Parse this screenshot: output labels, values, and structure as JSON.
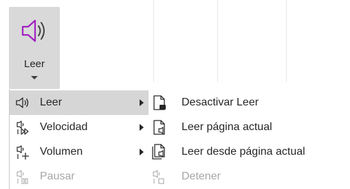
{
  "ribbon": {
    "read_button_label": "Leer",
    "accent_color": "#a020c0"
  },
  "menu": {
    "items": [
      {
        "label": "Leer",
        "icon": "speaker-icon",
        "has_submenu": true,
        "selected": true,
        "enabled": true
      },
      {
        "label": "Velocidad",
        "icon": "speed-icon",
        "has_submenu": true,
        "selected": false,
        "enabled": true
      },
      {
        "label": "Volumen",
        "icon": "volume-icon",
        "has_submenu": true,
        "selected": false,
        "enabled": true
      },
      {
        "label": "Pausar",
        "icon": "pause-icon",
        "has_submenu": false,
        "selected": false,
        "enabled": false
      }
    ]
  },
  "submenu": {
    "items": [
      {
        "label": "Desactivar Leer",
        "icon": "stop-reading-icon",
        "enabled": true
      },
      {
        "label": "Leer página actual",
        "icon": "read-page-icon",
        "enabled": true
      },
      {
        "label": "Leer desde página actual",
        "icon": "read-from-page-icon",
        "enabled": true
      },
      {
        "label": "Detener",
        "icon": "stop-icon",
        "enabled": false
      }
    ]
  }
}
